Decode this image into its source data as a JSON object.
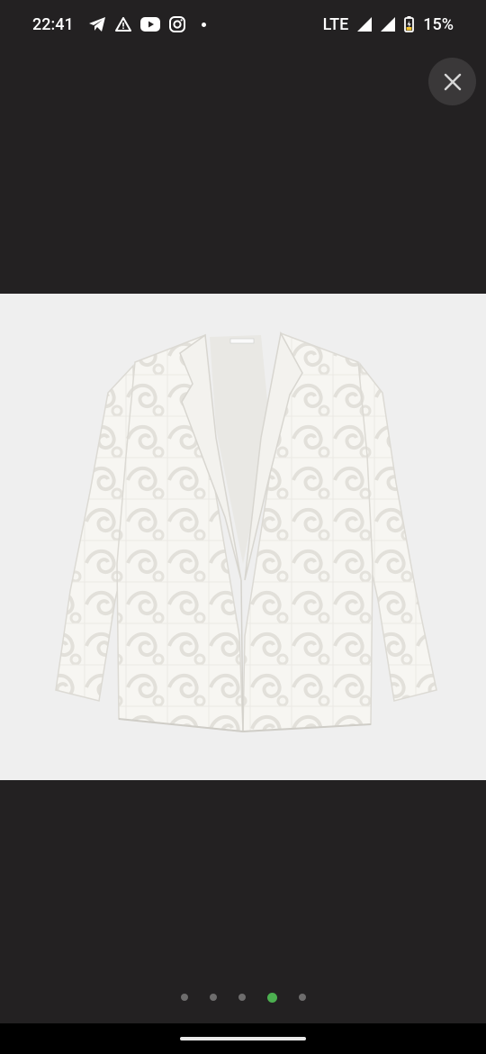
{
  "status_bar": {
    "time": "22:41",
    "left_icons": [
      "telegram-icon",
      "alert-icon",
      "youtube-icon",
      "instagram-icon",
      "notification-dot-icon"
    ],
    "network": "LTE",
    "battery_percent": "15%"
  },
  "viewer": {
    "close_icon": "close-icon",
    "image_description_name": "white-lace-blazer",
    "background_color": "#232122"
  },
  "pager": {
    "total": 5,
    "active_index": 3,
    "active_color": "#4caf50"
  }
}
